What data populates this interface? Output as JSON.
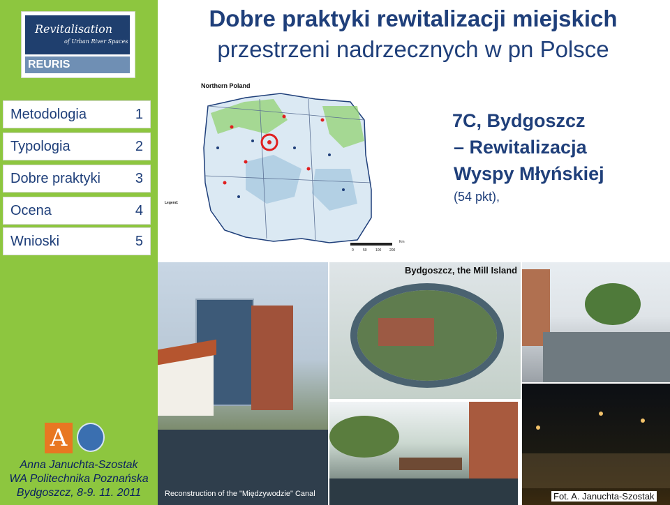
{
  "logo": {
    "title": "Revitalisation",
    "subtitle": "of Urban River Spaces",
    "acronym": "REURIS"
  },
  "title": {
    "line1": "Dobre praktyki rewitalizacji miejskich",
    "line2": "przestrzeni nadrzecznych w pn Polsce"
  },
  "nav": [
    {
      "label": "Metodologia",
      "num": "1"
    },
    {
      "label": "Typologia",
      "num": "2"
    },
    {
      "label": "Dobre praktyki",
      "num": "3"
    },
    {
      "label": "Ocena",
      "num": "4"
    },
    {
      "label": "Wnioski",
      "num": "5"
    }
  ],
  "example": {
    "code": "7C, Bydgoszcz",
    "line2": "– Rewitalizacja",
    "line3": "Wyspy Młyńskiej",
    "points": "(54 pkt),"
  },
  "map": {
    "title": "Northern Poland",
    "legend": "Legend:",
    "scale_unit": "Km",
    "scale_ticks": [
      "0",
      "50",
      "100",
      "200"
    ]
  },
  "photos": {
    "mill_island_caption": "Bydgoszcz, the Mill Island",
    "canal_caption": "Reconstruction of the \"Międzywodzie\" Canal",
    "credit": "Fot. A. Januchta-Szostak"
  },
  "credits": {
    "author": "Anna Januchta-Szostak",
    "institution": "WA Politechnika Poznańska",
    "place_date": "Bydgoszcz, 8-9. 11. 2011"
  },
  "colors": {
    "sidebar": "#8dc63f",
    "title": "#1f3f7a",
    "accent_red": "#e02020"
  }
}
